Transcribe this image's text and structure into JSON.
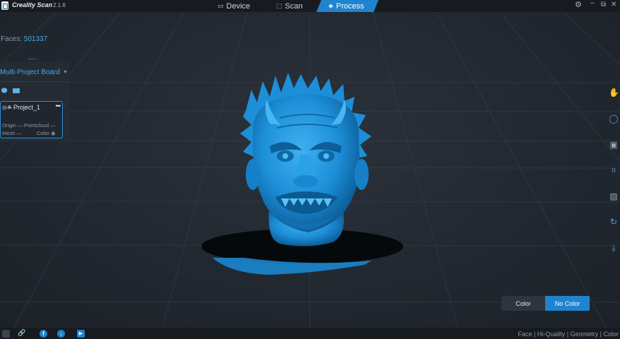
{
  "app": {
    "title": "Creality Scan",
    "version": "2.1.6"
  },
  "tabs": [
    {
      "label": "Device",
      "active": false
    },
    {
      "label": "Scan",
      "active": false
    },
    {
      "label": "Process",
      "active": true
    }
  ],
  "window_controls": [
    "gear-icon",
    "minimize-icon",
    "maximize-icon",
    "close-icon"
  ],
  "stats": {
    "faces_label": "Faces:",
    "faces_value": "501337"
  },
  "board": {
    "title": "Multi-Project Board",
    "project": {
      "name": "Project_1",
      "tags": [
        "Origin",
        "Pointcloud",
        "Mesh",
        "Color"
      ]
    }
  },
  "right_toolbar": [
    "hand-select-icon",
    "lasso-icon",
    "texture-icon",
    "crop-icon",
    "image-icon",
    "refresh-icon",
    "export-icon"
  ],
  "color_toggle": {
    "color_label": "Color",
    "no_color_label": "No Color",
    "selected": "No Color"
  },
  "status": "Face | Hi-Quality | Geometry | Color",
  "colors": {
    "accent": "#1f84cf",
    "model": "#1c8fd8",
    "background": "#1b2027"
  }
}
